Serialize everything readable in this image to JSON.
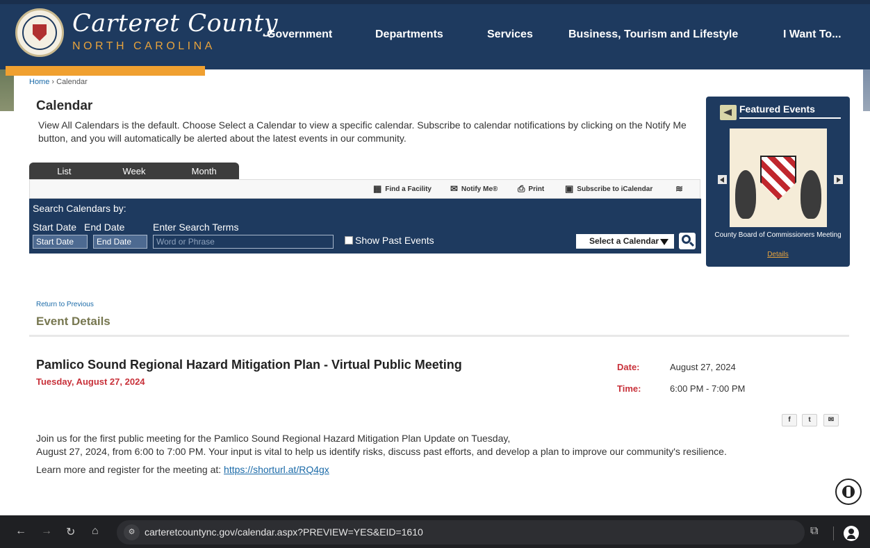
{
  "site": {
    "brand_title": "Carteret County",
    "brand_subtitle": "NORTH CAROLINA",
    "nav": [
      "Government",
      "Departments",
      "Services",
      "Business, Tourism and Lifestyle",
      "I Want To..."
    ],
    "brand_color": "#1e3a5f",
    "accent_color": "#f0a030"
  },
  "breadcrumb": {
    "home": "Home",
    "separator": " › ",
    "current": "Calendar"
  },
  "page": {
    "title": "Calendar",
    "intro": "View All Calendars is the default. Choose Select a Calendar to view a specific calendar. Subscribe to calendar notifications by clicking on the Notify Me button, and you will automatically be alerted about the latest events in our community."
  },
  "tabs": [
    "List",
    "Week",
    "Month"
  ],
  "toolbar": {
    "find_facility": "Find a Facility",
    "notify_me": "Notify Me®",
    "print": "Print",
    "subscribe": "Subscribe to iCalendar",
    "rss_icon": "rss-icon"
  },
  "search": {
    "heading": "Search Calendars by:",
    "start_label": "Start Date",
    "end_label": "End Date",
    "terms_label": "Enter Search Terms",
    "start_placeholder": "Start Date",
    "end_placeholder": "End Date",
    "terms_placeholder": "Word or Phrase",
    "show_past": "Show Past Events",
    "select_calendar": "Select a Calendar"
  },
  "featured": {
    "heading": "Featured Events",
    "caption": "County Board of Commissioners Meeting",
    "details": "Details"
  },
  "event": {
    "return_link": "Return to Previous",
    "section_title": "Event Details",
    "title": "Pamlico Sound Regional Hazard Mitigation Plan - Virtual Public Meeting",
    "date_long": "Tuesday, August 27, 2024",
    "date_label": "Date:",
    "date_value": "August 27, 2024",
    "time_label": "Time:",
    "time_value": "6:00 PM - 7:00 PM",
    "desc_line1": "Join us for the first public meeting for the Pamlico Sound Regional Hazard Mitigation Plan Update on Tuesday,",
    "desc_line2": "August 27, 2024, from 6:00 to 7:00 PM. Your input is vital to help us identify risks, discuss past efforts, and develop a plan to improve our community's resilience.",
    "learn_more": "Learn more and register for the meeting at: ",
    "link": "https://shorturl.at/RQ4gx",
    "share": {
      "facebook": "f",
      "twitter": "t",
      "email": "✉"
    }
  },
  "browser": {
    "url": "carteretcountync.gov/calendar.aspx?PREVIEW=YES&EID=1610"
  }
}
